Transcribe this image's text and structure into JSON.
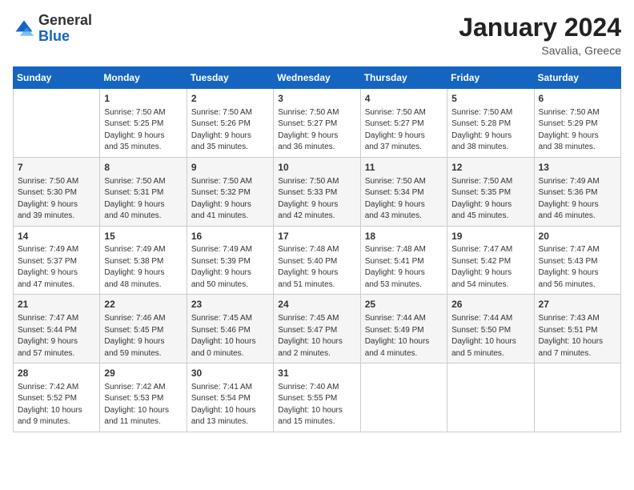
{
  "header": {
    "logo": {
      "general": "General",
      "blue": "Blue"
    },
    "title": "January 2024",
    "location": "Savalia, Greece"
  },
  "weekdays": [
    "Sunday",
    "Monday",
    "Tuesday",
    "Wednesday",
    "Thursday",
    "Friday",
    "Saturday"
  ],
  "weeks": [
    [
      {
        "day": null,
        "content": null
      },
      {
        "day": "1",
        "content": "Sunrise: 7:50 AM\nSunset: 5:25 PM\nDaylight: 9 hours\nand 35 minutes."
      },
      {
        "day": "2",
        "content": "Sunrise: 7:50 AM\nSunset: 5:26 PM\nDaylight: 9 hours\nand 35 minutes."
      },
      {
        "day": "3",
        "content": "Sunrise: 7:50 AM\nSunset: 5:27 PM\nDaylight: 9 hours\nand 36 minutes."
      },
      {
        "day": "4",
        "content": "Sunrise: 7:50 AM\nSunset: 5:27 PM\nDaylight: 9 hours\nand 37 minutes."
      },
      {
        "day": "5",
        "content": "Sunrise: 7:50 AM\nSunset: 5:28 PM\nDaylight: 9 hours\nand 38 minutes."
      },
      {
        "day": "6",
        "content": "Sunrise: 7:50 AM\nSunset: 5:29 PM\nDaylight: 9 hours\nand 38 minutes."
      }
    ],
    [
      {
        "day": "7",
        "content": "Sunrise: 7:50 AM\nSunset: 5:30 PM\nDaylight: 9 hours\nand 39 minutes."
      },
      {
        "day": "8",
        "content": "Sunrise: 7:50 AM\nSunset: 5:31 PM\nDaylight: 9 hours\nand 40 minutes."
      },
      {
        "day": "9",
        "content": "Sunrise: 7:50 AM\nSunset: 5:32 PM\nDaylight: 9 hours\nand 41 minutes."
      },
      {
        "day": "10",
        "content": "Sunrise: 7:50 AM\nSunset: 5:33 PM\nDaylight: 9 hours\nand 42 minutes."
      },
      {
        "day": "11",
        "content": "Sunrise: 7:50 AM\nSunset: 5:34 PM\nDaylight: 9 hours\nand 43 minutes."
      },
      {
        "day": "12",
        "content": "Sunrise: 7:50 AM\nSunset: 5:35 PM\nDaylight: 9 hours\nand 45 minutes."
      },
      {
        "day": "13",
        "content": "Sunrise: 7:49 AM\nSunset: 5:36 PM\nDaylight: 9 hours\nand 46 minutes."
      }
    ],
    [
      {
        "day": "14",
        "content": "Sunrise: 7:49 AM\nSunset: 5:37 PM\nDaylight: 9 hours\nand 47 minutes."
      },
      {
        "day": "15",
        "content": "Sunrise: 7:49 AM\nSunset: 5:38 PM\nDaylight: 9 hours\nand 48 minutes."
      },
      {
        "day": "16",
        "content": "Sunrise: 7:49 AM\nSunset: 5:39 PM\nDaylight: 9 hours\nand 50 minutes."
      },
      {
        "day": "17",
        "content": "Sunrise: 7:48 AM\nSunset: 5:40 PM\nDaylight: 9 hours\nand 51 minutes."
      },
      {
        "day": "18",
        "content": "Sunrise: 7:48 AM\nSunset: 5:41 PM\nDaylight: 9 hours\nand 53 minutes."
      },
      {
        "day": "19",
        "content": "Sunrise: 7:47 AM\nSunset: 5:42 PM\nDaylight: 9 hours\nand 54 minutes."
      },
      {
        "day": "20",
        "content": "Sunrise: 7:47 AM\nSunset: 5:43 PM\nDaylight: 9 hours\nand 56 minutes."
      }
    ],
    [
      {
        "day": "21",
        "content": "Sunrise: 7:47 AM\nSunset: 5:44 PM\nDaylight: 9 hours\nand 57 minutes."
      },
      {
        "day": "22",
        "content": "Sunrise: 7:46 AM\nSunset: 5:45 PM\nDaylight: 9 hours\nand 59 minutes."
      },
      {
        "day": "23",
        "content": "Sunrise: 7:45 AM\nSunset: 5:46 PM\nDaylight: 10 hours\nand 0 minutes."
      },
      {
        "day": "24",
        "content": "Sunrise: 7:45 AM\nSunset: 5:47 PM\nDaylight: 10 hours\nand 2 minutes."
      },
      {
        "day": "25",
        "content": "Sunrise: 7:44 AM\nSunset: 5:49 PM\nDaylight: 10 hours\nand 4 minutes."
      },
      {
        "day": "26",
        "content": "Sunrise: 7:44 AM\nSunset: 5:50 PM\nDaylight: 10 hours\nand 5 minutes."
      },
      {
        "day": "27",
        "content": "Sunrise: 7:43 AM\nSunset: 5:51 PM\nDaylight: 10 hours\nand 7 minutes."
      }
    ],
    [
      {
        "day": "28",
        "content": "Sunrise: 7:42 AM\nSunset: 5:52 PM\nDaylight: 10 hours\nand 9 minutes."
      },
      {
        "day": "29",
        "content": "Sunrise: 7:42 AM\nSunset: 5:53 PM\nDaylight: 10 hours\nand 11 minutes."
      },
      {
        "day": "30",
        "content": "Sunrise: 7:41 AM\nSunset: 5:54 PM\nDaylight: 10 hours\nand 13 minutes."
      },
      {
        "day": "31",
        "content": "Sunrise: 7:40 AM\nSunset: 5:55 PM\nDaylight: 10 hours\nand 15 minutes."
      },
      {
        "day": null,
        "content": null
      },
      {
        "day": null,
        "content": null
      },
      {
        "day": null,
        "content": null
      }
    ]
  ]
}
